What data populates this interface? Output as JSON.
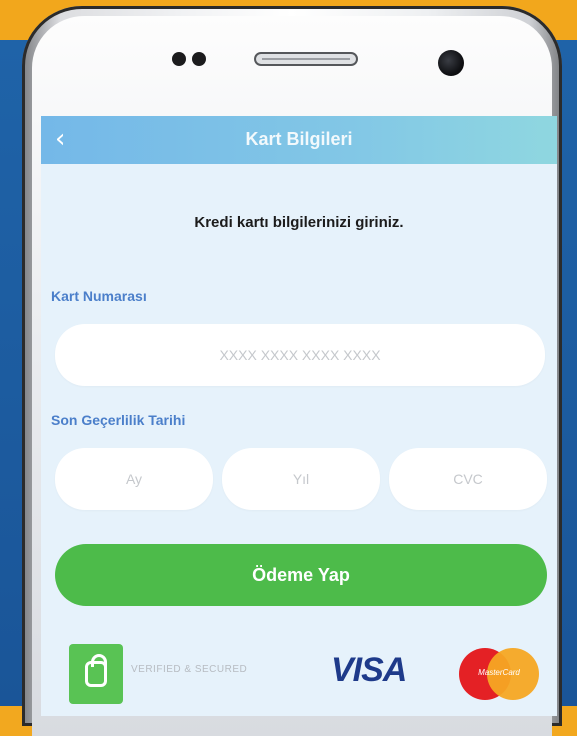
{
  "app": {
    "title": "Kart Bilgileri",
    "back_icon": "chevron-left-icon"
  },
  "form": {
    "instruction": "Kredi kartı bilgilerinizi giriniz.",
    "card_number_label": "Kart Numarası",
    "card_number_placeholder": "XXXX XXXX XXXX XXXX",
    "expiry_label": "Son Geçerlilik Tarihi",
    "month_placeholder": "Ay",
    "year_placeholder": "Yıl",
    "cvc_placeholder": "CVC",
    "pay_button": "Ödeme Yap"
  },
  "footer": {
    "secure_text": "VERIFIED & SECURED",
    "visa_text": "VISA",
    "mastercard_text": "MasterCard"
  },
  "colors": {
    "accent_green": "#4dbb4a",
    "label_blue": "#4b7fca",
    "appbar": "#7fc3e6",
    "background_top": "#f2a81f",
    "background_body": "#1f63a8"
  }
}
